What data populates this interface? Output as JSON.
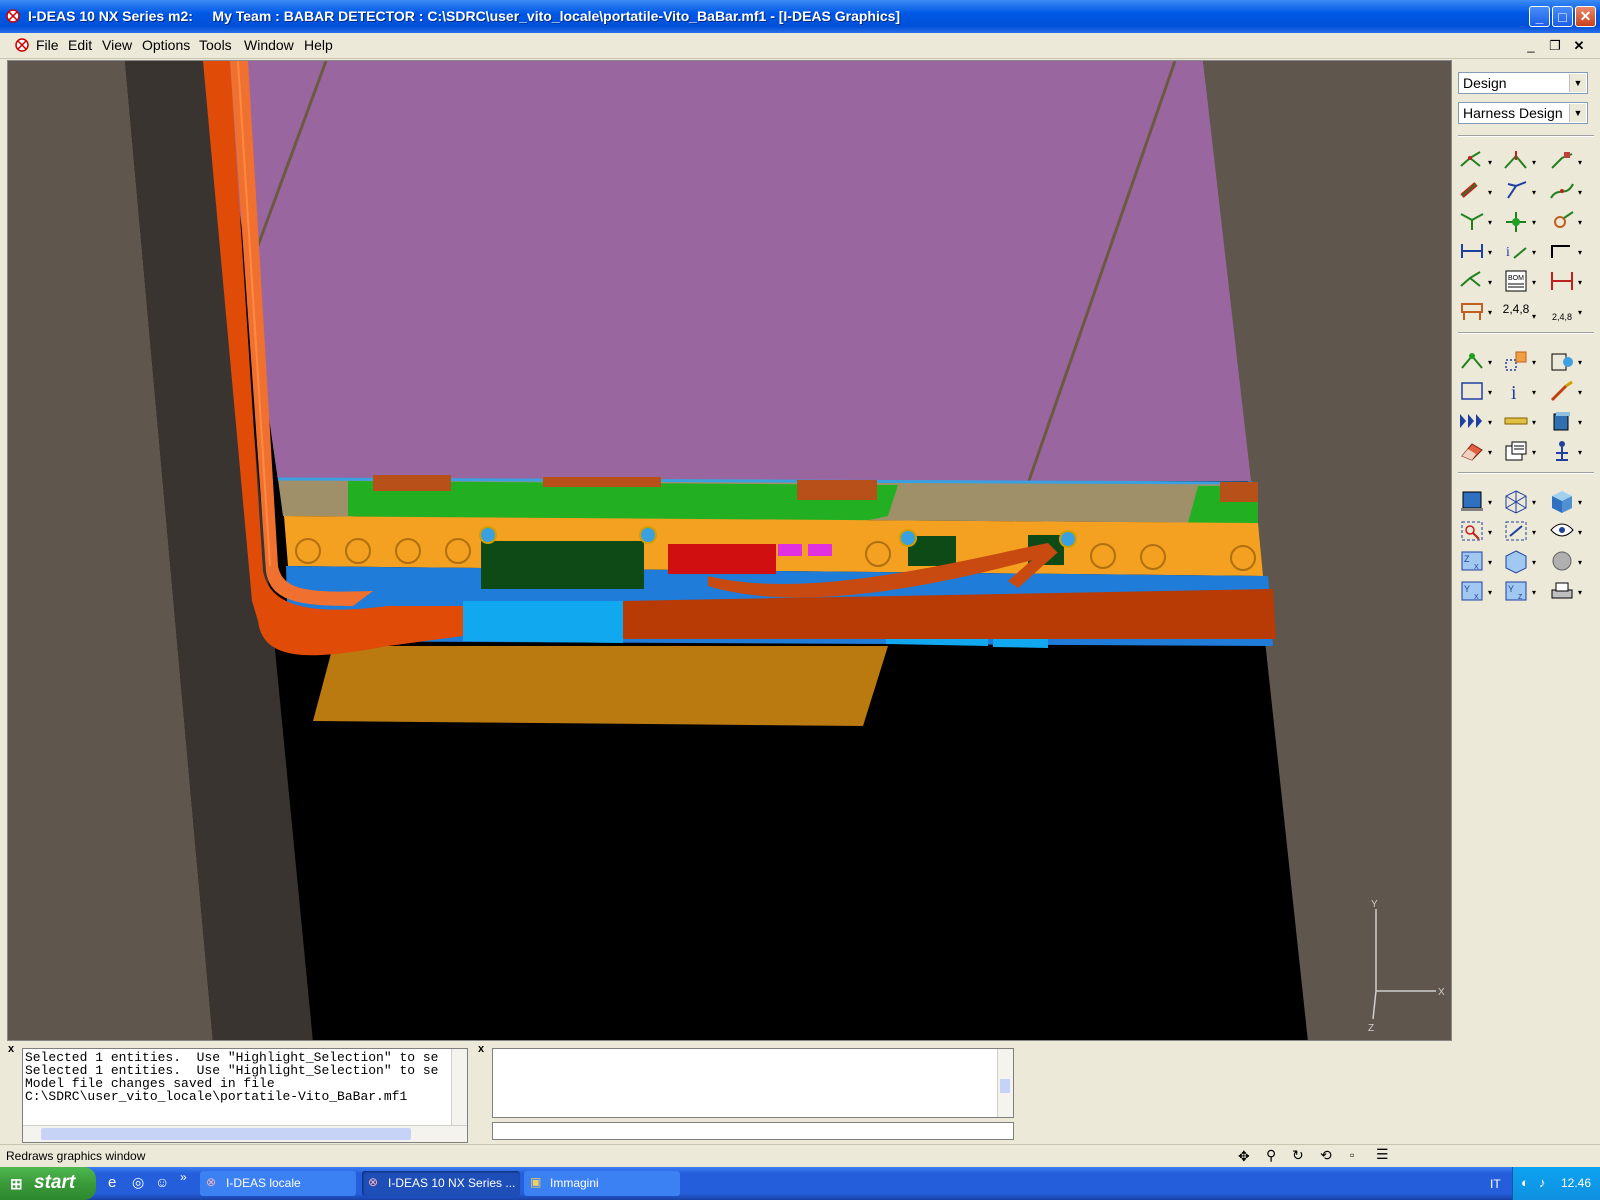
{
  "window": {
    "title": "I-DEAS 10 NX Series m2:     My Team : BABAR DETECTOR : C:\\SDRC\\user_vito_locale\\portatile-Vito_BaBar.mf1 - [I-DEAS Graphics]"
  },
  "menu": {
    "items": [
      "File",
      "Edit",
      "View",
      "Options",
      "Tools",
      "Window",
      "Help"
    ]
  },
  "panel": {
    "application": "Design",
    "task": "Harness Design"
  },
  "toolbar": {
    "labels": {
      "numbering_a": "2,4,8",
      "numbering_b": "2,4,8"
    }
  },
  "listing": {
    "lines": [
      "Selected 1 entities.  Use \"Highlight_Selection\" to se",
      "Selected 1 entities.  Use \"Highlight_Selection\" to se",
      "Model file changes saved in file",
      "C:\\SDRC\\user_vito_locale\\portatile-Vito_BaBar.mf1"
    ]
  },
  "status": {
    "text": "Redraws graphics window"
  },
  "axes": {
    "y": "Y",
    "x": "X",
    "z": "Z"
  },
  "taskbar": {
    "start_label": "start",
    "items": [
      "I-DEAS locale",
      "I-DEAS 10 NX Series ...",
      "Immagini"
    ],
    "language": "IT",
    "clock": "12.46"
  },
  "colors": {
    "titlebar": "#0058e6",
    "viewport_bg": "#000000",
    "wall": "#5f564d",
    "magenta_plane": "#9966a0",
    "orange_cable": "#e04b08",
    "taskbar": "#245edb",
    "start_green": "#3a9a3a"
  }
}
